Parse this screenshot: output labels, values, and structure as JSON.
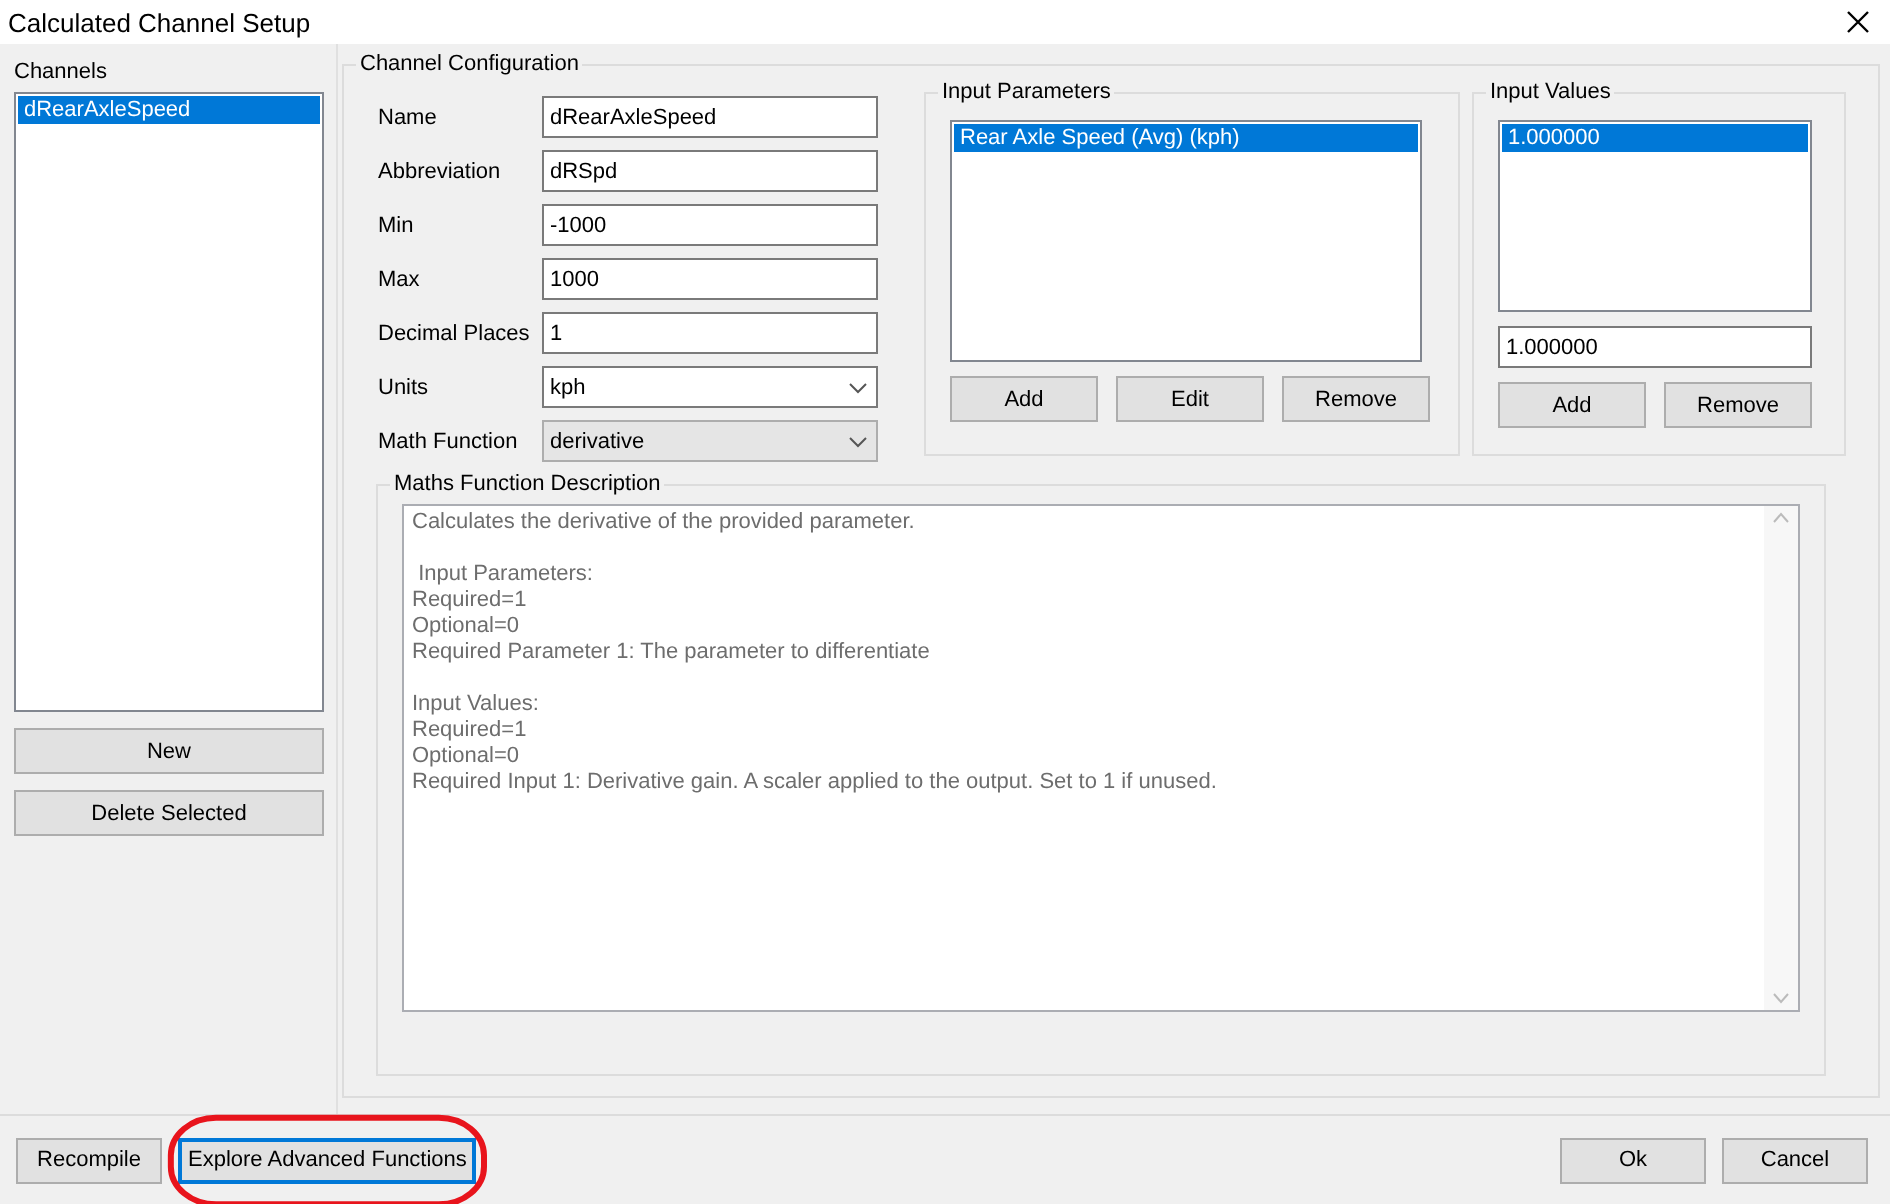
{
  "window": {
    "title": "Calculated Channel Setup"
  },
  "channels": {
    "title": "Channels",
    "items": [
      {
        "label": "dRearAxleSpeed",
        "selected": true
      }
    ],
    "buttons": [
      "New",
      "Delete Selected"
    ]
  },
  "channel_configuration": {
    "title": "Channel Configuration",
    "fields": [
      {
        "label": "Name",
        "value": "dRearAxleSpeed",
        "kind": "text"
      },
      {
        "label": "Abbreviation",
        "value": "dRSpd",
        "kind": "text"
      },
      {
        "label": "Min",
        "value": "-1000",
        "kind": "text"
      },
      {
        "label": "Max",
        "value": "1000",
        "kind": "text"
      },
      {
        "label": "Decimal Places",
        "value": "1",
        "kind": "text"
      },
      {
        "label": "Units",
        "value": "kph",
        "kind": "combo"
      },
      {
        "label": "Math Function",
        "value": "derivative",
        "kind": "droplist"
      }
    ],
    "input_parameters": {
      "title": "Input Parameters",
      "items": [
        {
          "label": "Rear Axle Speed (Avg) (kph)",
          "selected": true
        }
      ],
      "buttons": [
        "Add",
        "Edit",
        "Remove"
      ]
    },
    "input_values": {
      "title": "Input Values",
      "items": [
        {
          "label": "1.000000",
          "selected": true
        }
      ],
      "value": "1.000000",
      "buttons": [
        "Add",
        "Remove"
      ]
    },
    "description": {
      "title": "Maths Function Description",
      "text": "Calculates the derivative of the provided parameter.\n\n Input Parameters:\nRequired=1\nOptional=0\nRequired Parameter 1: The parameter to differentiate\n\nInput Values:\nRequired=1\nOptional=0\nRequired Input 1: Derivative gain. A scaler applied to the output. Set to 1 if unused."
    }
  },
  "footer": {
    "buttons": [
      {
        "label": "Recompile",
        "focused": false,
        "highlighted": false
      },
      {
        "label": "Explore Advanced Functions",
        "focused": true,
        "highlighted": true
      }
    ],
    "right_buttons": [
      "Ok",
      "Cancel"
    ]
  }
}
